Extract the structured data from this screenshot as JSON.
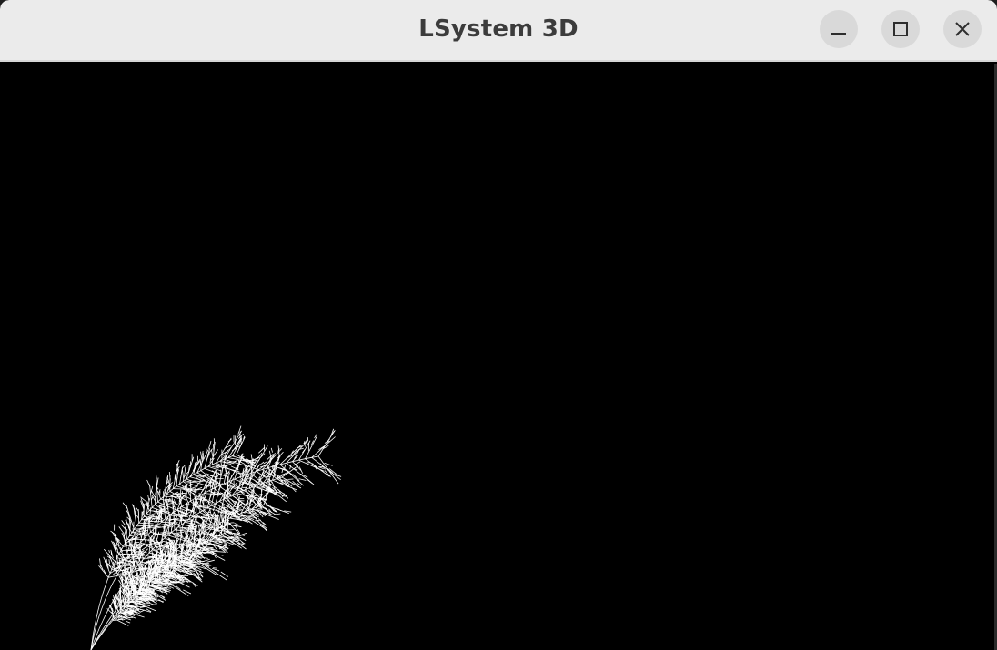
{
  "window": {
    "title": "LSystem 3D"
  },
  "controls": {
    "minimize_icon": "minimize-icon",
    "maximize_icon": "maximize-icon",
    "close_icon": "close-icon"
  },
  "colors": {
    "titlebar_bg": "#ebebeb",
    "button_bg": "#d9d9d9",
    "canvas_bg": "#000000",
    "plant_stroke": "#ffffff",
    "title_text": "#3c3c3c"
  }
}
